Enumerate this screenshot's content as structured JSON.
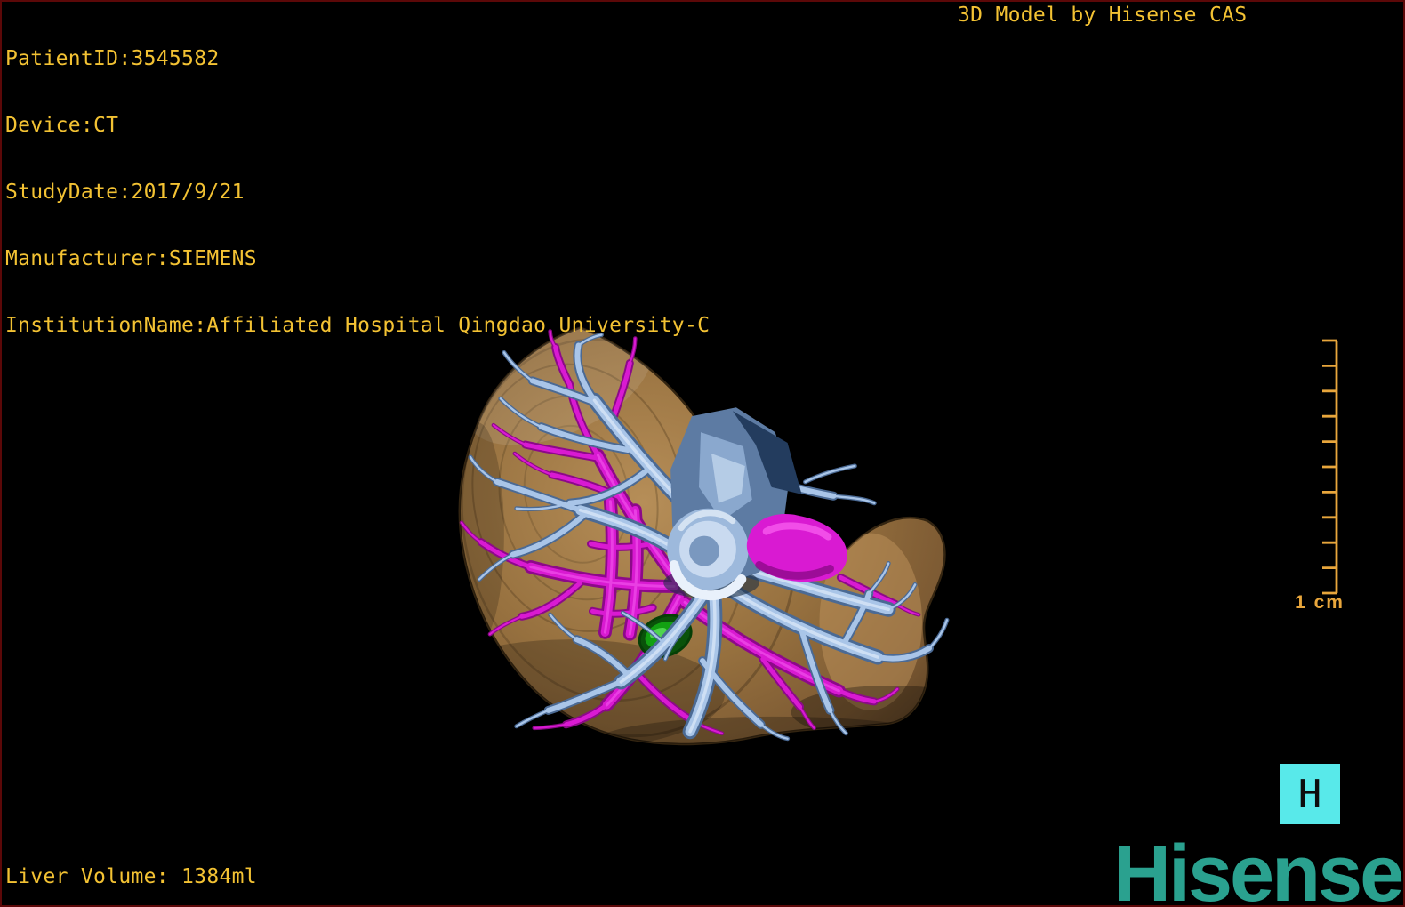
{
  "overlay": {
    "text_color": "#f3c233",
    "patient_info_lines": [
      "PatientID:3545582",
      "Device:CT",
      "StudyDate:2017/9/21",
      "Manufacturer:SIEMENS",
      "InstitutionName:Affiliated Hospital Qingdao University-C"
    ],
    "watermark": "3D Model by Hisense CAS",
    "liver_volume": "Liver Volume: 1384ml"
  },
  "scale_bar": {
    "label": "1 cm",
    "color": "#e8a63c",
    "divisions": 10
  },
  "orientation_button": {
    "label": "H",
    "background_color": "#58e9ea",
    "text_color": "#0d0d0d"
  },
  "brand": {
    "name": "Hisense",
    "color": "#2aa18f"
  },
  "viewport": {
    "background_color": "#000000",
    "border_color": "#5c0808",
    "model": {
      "subject": "3D liver reconstruction with portal veins, hepatic arteries, IVC and green lesion",
      "colors": {
        "liver_light": "#b68e58",
        "liver_mid": "#97713f",
        "liver_dark": "#5e4325",
        "portal_vein_light": "#a9c5e8",
        "portal_vein_dark": "#4b6a94",
        "vein_sheen": "#e2edfa",
        "artery_light": "#d91ad2",
        "artery_dark": "#8c0989",
        "artery_sheen": "#f459ee",
        "ivc_dark": "#233c5e",
        "ivc_mid": "#5d7ba3",
        "ivc_light": "#c9daf0",
        "lesion_green": "#12a012",
        "lesion_dark": "#0a520a"
      }
    }
  }
}
